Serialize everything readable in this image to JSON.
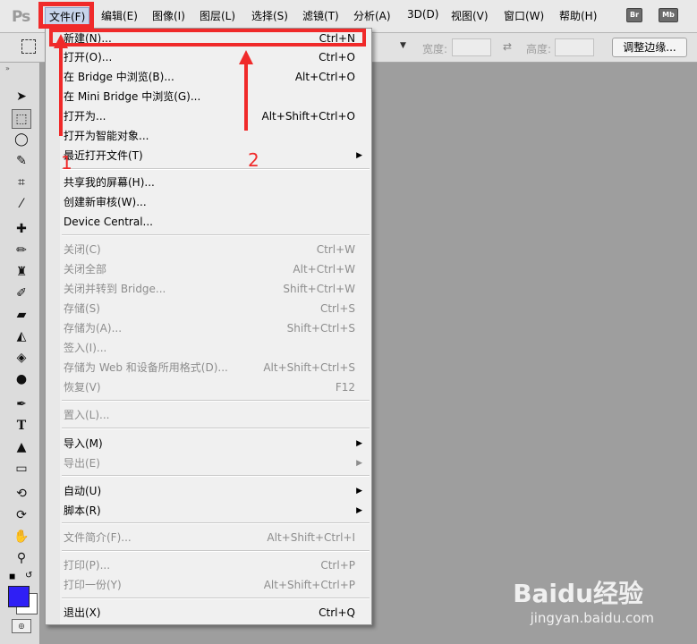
{
  "app_logo": "Ps",
  "menubar": {
    "items": [
      "文件(F)",
      "编辑(E)",
      "图像(I)",
      "图层(L)",
      "选择(S)",
      "滤镜(T)",
      "分析(A)",
      "3D(D)",
      "视图(V)",
      "窗口(W)",
      "帮助(H)"
    ],
    "bridge_buttons": [
      "Br",
      "Mb"
    ]
  },
  "options_bar": {
    "width_label": "宽度:",
    "height_label": "高度:",
    "refine_edge_button": "调整边缘..."
  },
  "file_menu": {
    "items": [
      {
        "label": "新建(N)...",
        "shortcut": "Ctrl+N"
      },
      {
        "label": "打开(O)...",
        "shortcut": "Ctrl+O"
      },
      {
        "label": "在 Bridge 中浏览(B)...",
        "shortcut": "Alt+Ctrl+O"
      },
      {
        "label": "在 Mini Bridge 中浏览(G)...",
        "shortcut": ""
      },
      {
        "label": "打开为...",
        "shortcut": "Alt+Shift+Ctrl+O"
      },
      {
        "label": "打开为智能对象...",
        "shortcut": ""
      },
      {
        "label": "最近打开文件(T)",
        "shortcut": ""
      },
      {
        "label": "共享我的屏幕(H)...",
        "shortcut": ""
      },
      {
        "label": "创建新审核(W)...",
        "shortcut": ""
      },
      {
        "label": "Device Central...",
        "shortcut": ""
      },
      {
        "label": "关闭(C)",
        "shortcut": "Ctrl+W"
      },
      {
        "label": "关闭全部",
        "shortcut": "Alt+Ctrl+W"
      },
      {
        "label": "关闭并转到 Bridge...",
        "shortcut": "Shift+Ctrl+W"
      },
      {
        "label": "存储(S)",
        "shortcut": "Ctrl+S"
      },
      {
        "label": "存储为(A)...",
        "shortcut": "Shift+Ctrl+S"
      },
      {
        "label": "签入(I)...",
        "shortcut": ""
      },
      {
        "label": "存储为 Web 和设备所用格式(D)...",
        "shortcut": "Alt+Shift+Ctrl+S"
      },
      {
        "label": "恢复(V)",
        "shortcut": "F12"
      },
      {
        "label": "置入(L)...",
        "shortcut": ""
      },
      {
        "label": "导入(M)",
        "shortcut": ""
      },
      {
        "label": "导出(E)",
        "shortcut": ""
      },
      {
        "label": "自动(U)",
        "shortcut": ""
      },
      {
        "label": "脚本(R)",
        "shortcut": ""
      },
      {
        "label": "文件简介(F)...",
        "shortcut": "Alt+Shift+Ctrl+I"
      },
      {
        "label": "打印(P)...",
        "shortcut": "Ctrl+P"
      },
      {
        "label": "打印一份(Y)",
        "shortcut": "Alt+Shift+Ctrl+P"
      },
      {
        "label": "退出(X)",
        "shortcut": "Ctrl+Q"
      }
    ]
  },
  "annotations": {
    "step1": "1",
    "step2": "2",
    "color": "#f02a2a"
  },
  "watermark": {
    "brand": "Baidu经验",
    "url": "jingyan.baidu.com"
  },
  "colors": {
    "foreground": "#2f1ff5",
    "background": "#ffffff"
  }
}
